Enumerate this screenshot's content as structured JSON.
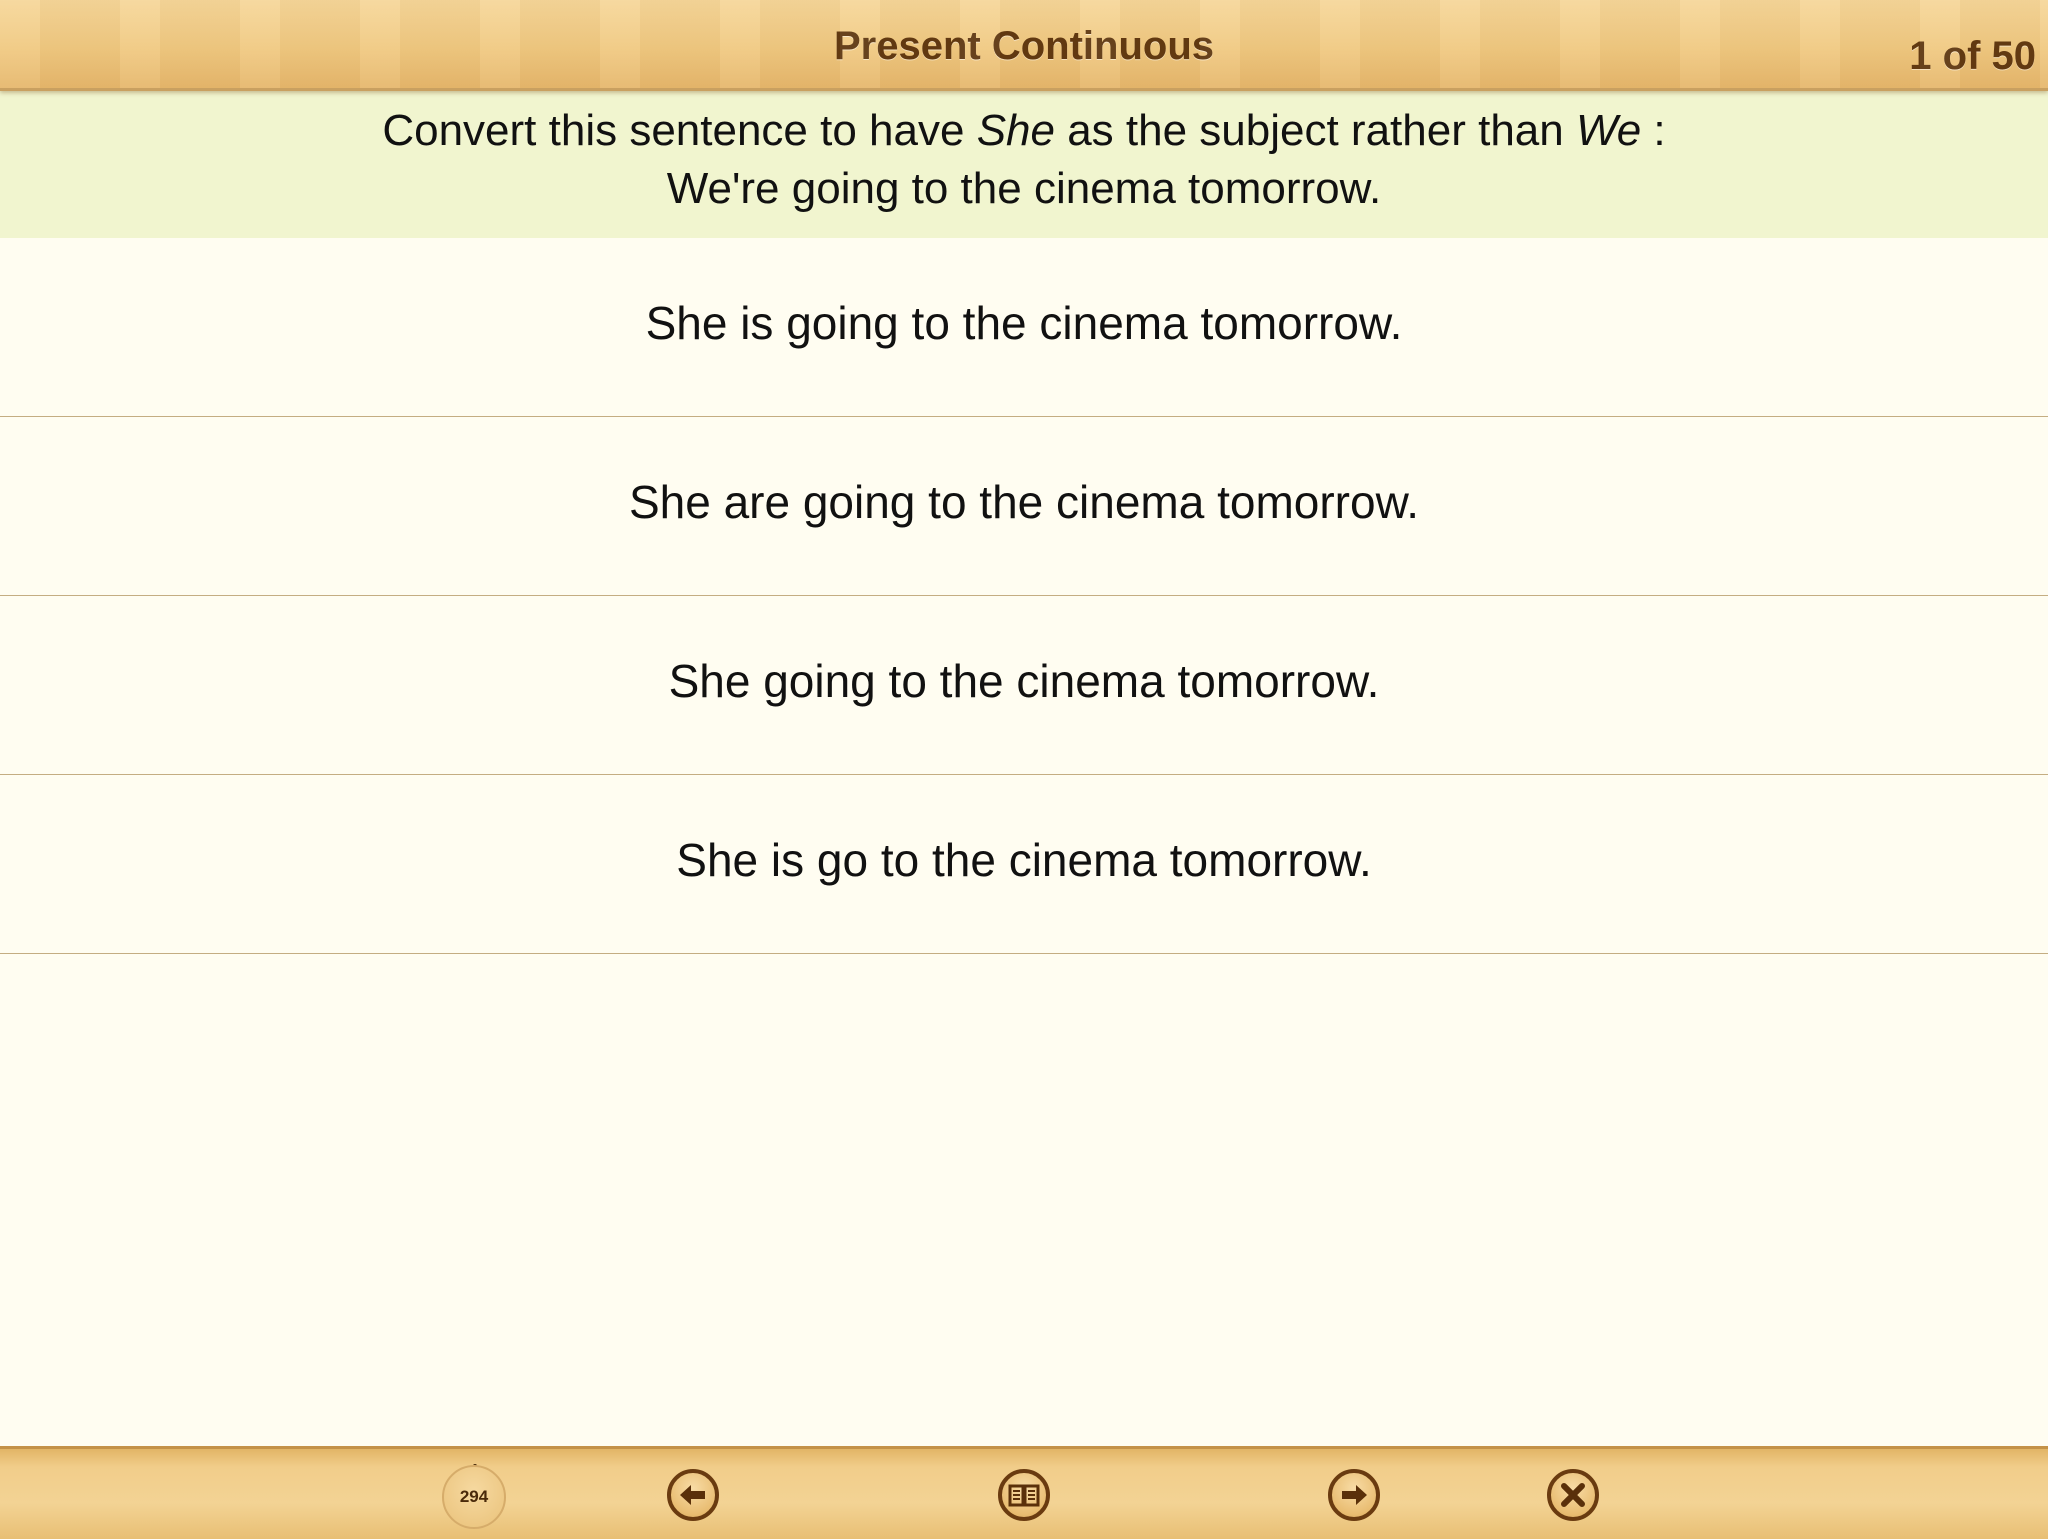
{
  "header": {
    "title": "Present Continuous",
    "progress": "1 of 50"
  },
  "question": {
    "line1_prefix": "Convert this sentence to have ",
    "line1_subject_new": "She",
    "line1_middle": " as the subject rather than ",
    "line1_subject_old": "We",
    "line1_suffix": " :",
    "line2": "We're going to the cinema tomorrow."
  },
  "answers": [
    {
      "text": "She is going to the cinema tomorrow."
    },
    {
      "text": "She are going to the cinema tomorrow."
    },
    {
      "text": "She going to the cinema tomorrow."
    },
    {
      "text": "She is go to the cinema tomorrow."
    }
  ],
  "toolbar": {
    "counter": "294",
    "buttons": [
      {
        "icon": "arrow-left-icon"
      },
      {
        "icon": "book-icon"
      },
      {
        "icon": "arrow-right-icon"
      },
      {
        "icon": "close-icon"
      }
    ]
  },
  "colors": {
    "header_text": "#5e360f",
    "prompt_background": "#f1f5cf",
    "content_background": "#fffdf1"
  }
}
